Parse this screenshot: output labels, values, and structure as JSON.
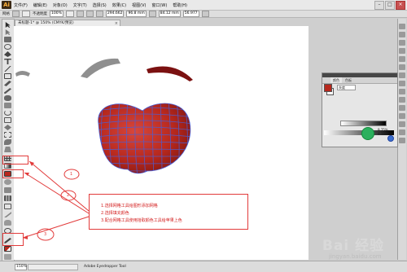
{
  "app": {
    "logo": "Ai"
  },
  "menu": [
    "文件(F)",
    "编辑(E)",
    "对象(O)",
    "文字(T)",
    "选择(S)",
    "效果(C)",
    "视图(V)",
    "窗口(W)",
    "帮助(H)"
  ],
  "window_controls": {
    "minimize": "–",
    "maximize": "□",
    "close": "×"
  },
  "controlbar": {
    "label": "网格",
    "fill_label": "不透明度",
    "opacity_value": "100%",
    "x_value": "294.662",
    "y_value": "96.8 mm",
    "w_value": "84.12 mm",
    "h_value": "56.977"
  },
  "document_tab": {
    "title": "未标题-1* @ 150% (CMYK/预览)",
    "close": "×"
  },
  "color_panel": {
    "tabs": [
      "颜色",
      "色板"
    ],
    "mode_label": "灰度",
    "percent_top": "9.75%",
    "percent_bottom": "4.36%"
  },
  "statusbar": {
    "zoom": "150%",
    "current_tool": "Adobe Eyedropper Tool"
  },
  "annotation": {
    "lines": [
      "1.选择网格工具给图形添加网格",
      "2.选择填充颜色",
      "3.配合网格工具使用拾取颜色工具给苹果上色"
    ],
    "callouts": [
      "1",
      "2",
      "3"
    ]
  },
  "watermark": {
    "brand": "Bai 经验",
    "url": "jingyan.baidu.com"
  },
  "colors": {
    "accent_red": "#e23b3b",
    "apple_red": "#b7281d",
    "mesh_blue": "#4a5fd6",
    "brow_gray": "#8f8f8f",
    "brow_dark_red": "#7b1111"
  }
}
